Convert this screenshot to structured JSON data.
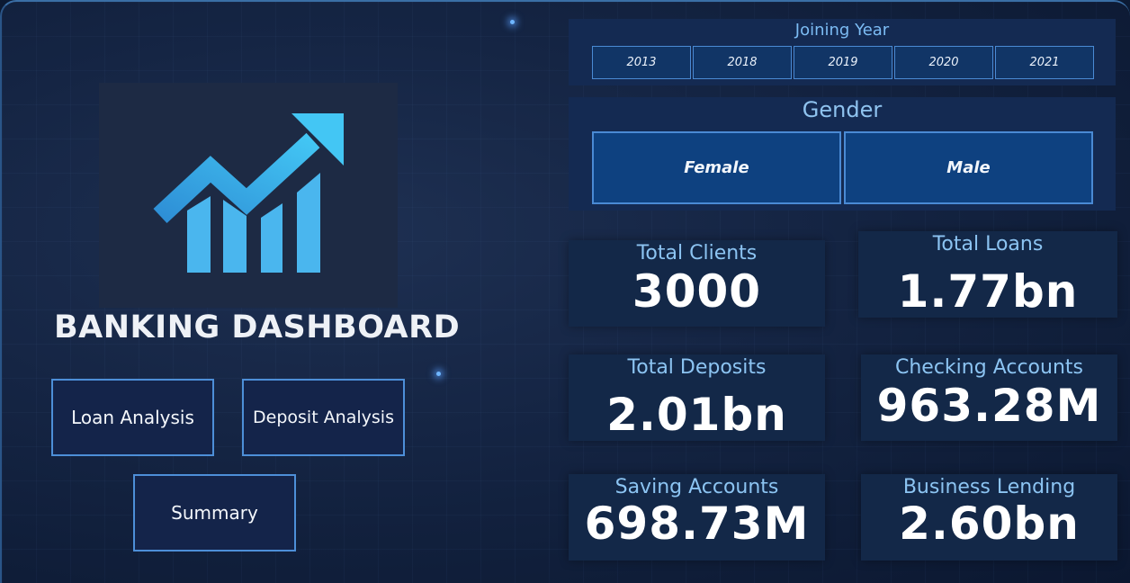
{
  "brand": {
    "title": "BANKING DASHBOARD",
    "logo_icon": "growth-chart-arrow-icon",
    "accent": "#3fb4ee"
  },
  "nav": {
    "loan_analysis": "Loan Analysis",
    "deposit_analysis": "Deposit Analysis",
    "summary": "Summary"
  },
  "filters": {
    "joining_year": {
      "title": "Joining Year",
      "options": [
        "2013",
        "2018",
        "2019",
        "2020",
        "2021"
      ]
    },
    "gender": {
      "title": "Gender",
      "options": [
        "Female",
        "Male"
      ]
    }
  },
  "kpis": [
    {
      "label": "Total Clients",
      "value": "3000"
    },
    {
      "label": "Total Loans",
      "value": "1.77bn"
    },
    {
      "label": "Total Deposits",
      "value": "2.01bn"
    },
    {
      "label": "Checking Accounts",
      "value": "963.28M"
    },
    {
      "label": "Saving Accounts",
      "value": "698.73M"
    },
    {
      "label": "Business Lending",
      "value": "2.60bn"
    }
  ],
  "colors": {
    "background": "#0f1d38",
    "panel": "#142a52",
    "button_border": "#4d8fd8",
    "label_blue": "#8cc4f2",
    "value_white": "#ffffff"
  }
}
